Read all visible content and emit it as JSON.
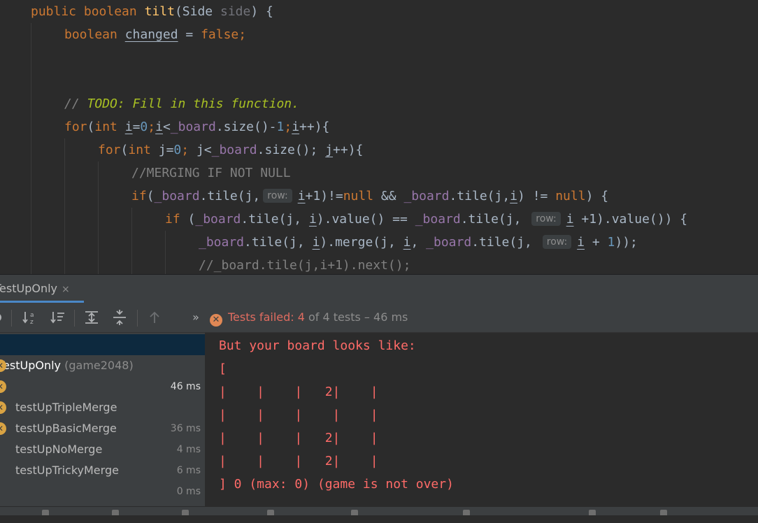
{
  "editor": {
    "signature": {
      "kw_public": "public",
      "kw_boolean": "boolean",
      "method": "tilt",
      "open": "(",
      "type": "Side",
      "param": "side",
      "close": ") {"
    },
    "changed": {
      "kw_boolean": "boolean",
      "var": "changed",
      "eq": " = ",
      "kw_false": "false",
      "semi": ";"
    },
    "todo": {
      "slashes": "// ",
      "text": "TODO: Fill in this function."
    },
    "for1": {
      "kw_for": "for",
      "open": "(",
      "kw_int": "int",
      "var_i": "i",
      "eq": "=",
      "zero": "0",
      "semi1": ";",
      "var_i2": "i",
      "lt": "<",
      "field": "_board",
      "call": ".size()-",
      "one": "1",
      "semi2": ";",
      "var_i3": "i",
      "tail": "++){"
    },
    "for2": {
      "kw_for": "for",
      "open": "(",
      "kw_int": "int",
      "var_j": "j",
      "eq": "=",
      "zero": "0",
      "semi1": "; ",
      "var_j2": "j",
      "lt": "<",
      "field": "_board",
      "call": ".size(); ",
      "var_j3": "j",
      "tail": "++){"
    },
    "merge_comment": "//MERGING IF NOT NULL",
    "if1": {
      "kw_if": "if",
      "open": "(",
      "field1": "_board",
      "call1": ".tile(j,",
      "hint": "row:",
      "var_i": "i",
      "mid1": "+1)!=",
      "kw_null1": "null",
      "mid2": " && ",
      "field2": "_board",
      "call2": ".tile(j,",
      "var_i2": "i",
      "mid3": ") != ",
      "kw_null2": "null",
      "tail": ") {"
    },
    "if2": {
      "kw_if": "if",
      "open": " (",
      "field1": "_board",
      "call1": ".tile(j, ",
      "var_i": "i",
      "mid1": ").value() == ",
      "field2": "_board",
      "call2": ".tile(j, ",
      "hint": "row:",
      "var_i2": "i",
      "tail": " +1).value()) {"
    },
    "merge": {
      "field1": "_board",
      "call1": ".tile(j, ",
      "var_i": "i",
      "mid1": ").merge(j, ",
      "var_i2": "i",
      "comma": ", ",
      "field2": "_board",
      "call2": ".tile(j, ",
      "hint": "row:",
      "var_i3": "i",
      "mid2": " + ",
      "one": "1",
      "tail": "));"
    },
    "next_comment": "//_board.tile(j,i+1).next();"
  },
  "run_panel": {
    "tab_label": "TestUpOnly",
    "tab_close": "×",
    "toolbar": {
      "overflow": "»",
      "status_failed": "Tests failed: ",
      "failed_count": "4",
      "status_rest": " of 4 tests – 46 ms"
    },
    "tree": {
      "root": {
        "name": "TestUpOnly",
        "package": " (game2048)",
        "time": "46 ms"
      },
      "items": [
        {
          "name": "testUpTripleMerge",
          "time": "36 ms"
        },
        {
          "name": "testUpBasicMerge",
          "time": "4 ms"
        },
        {
          "name": "testUpNoMerge",
          "time": "6 ms"
        },
        {
          "name": "testUpTrickyMerge",
          "time": "0 ms"
        }
      ]
    },
    "console": {
      "lines": [
        "But your board looks like:",
        "[",
        "|    |    |   2|    |",
        "|    |    |    |    |",
        "|    |    |   2|    |",
        "|    |    |   2|    |",
        "] 0 (max: 0) (game is not over)"
      ]
    }
  },
  "colors": {
    "editor_bg": "#2b2b2b",
    "keyword": "#cc7832",
    "function": "#ffc66d",
    "number": "#6897bb",
    "field": "#9876aa",
    "todo": "#a8c023",
    "console_error": "#ff6b68",
    "fail_icon": "#e08855",
    "selected_row": "#0d293e"
  },
  "icons": [
    "sort-alpha-icon",
    "sort-duration-icon",
    "expand-all-icon",
    "collapse-all-icon",
    "prev-failed-icon",
    "failed-test-icon",
    "close-icon"
  ]
}
